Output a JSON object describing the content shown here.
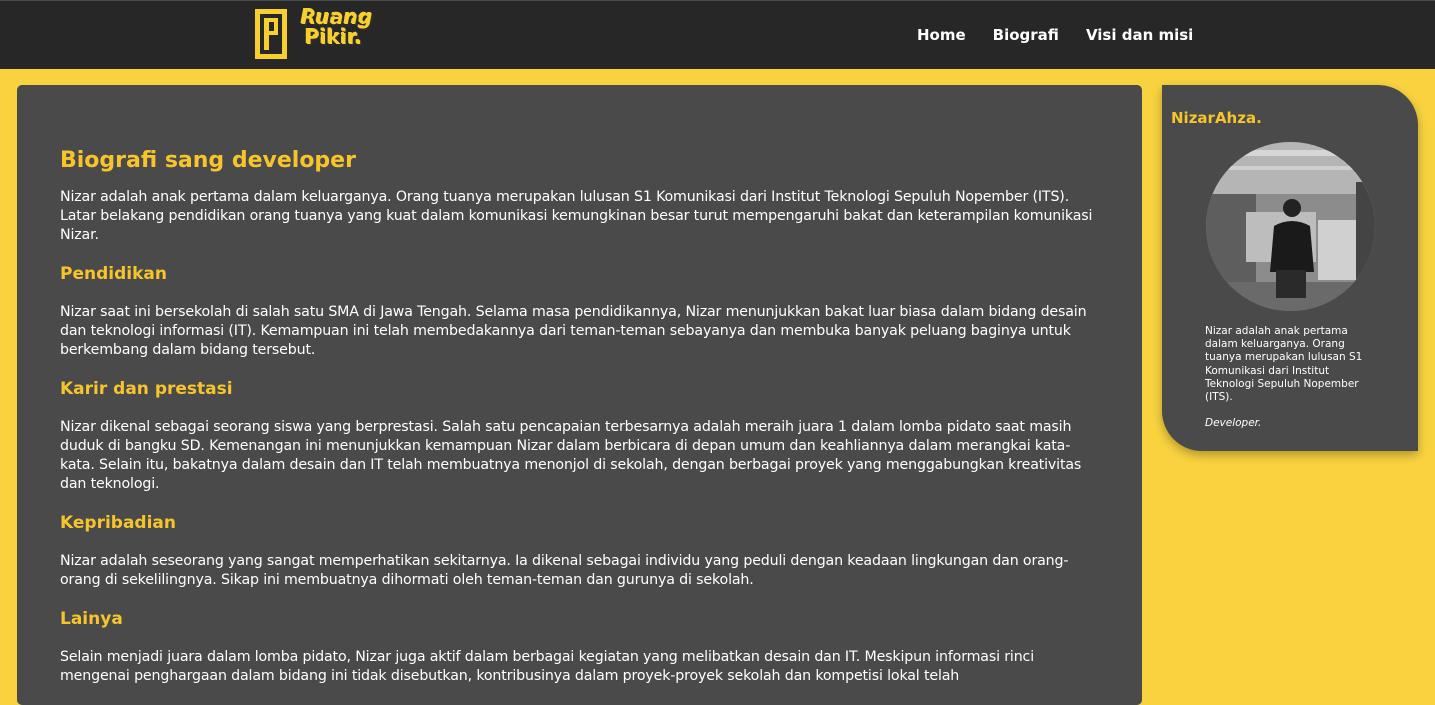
{
  "nav": {
    "logo": {
      "line1": "Ruang",
      "line2": "Pikir."
    },
    "links": [
      "Home",
      "Biografi",
      "Visi dan misi"
    ]
  },
  "main": {
    "title": "Biografi sang developer",
    "intro": "Nizar adalah anak pertama dalam keluarganya. Orang tuanya merupakan lulusan S1 Komunikasi dari Institut Teknologi Sepuluh Nopember (ITS). Latar belakang pendidikan orang tuanya yang kuat dalam komunikasi kemungkinan besar turut mempengaruhi bakat dan keterampilan komunikasi Nizar.",
    "sections": [
      {
        "title": "Pendidikan",
        "text": "Nizar saat ini bersekolah di salah satu SMA di Jawa Tengah. Selama masa pendidikannya, Nizar menunjukkan bakat luar biasa dalam bidang desain dan teknologi informasi (IT). Kemampuan ini telah membedakannya dari teman-teman sebayanya dan membuka banyak peluang baginya untuk berkembang dalam bidang tersebut."
      },
      {
        "title": "Karir dan prestasi",
        "text": "Nizar dikenal sebagai seorang siswa yang berprestasi. Salah satu pencapaian terbesarnya adalah meraih juara 1 dalam lomba pidato saat masih duduk di bangku SD. Kemenangan ini menunjukkan kemampuan Nizar dalam berbicara di depan umum dan keahliannya dalam merangkai kata-kata. Selain itu, bakatnya dalam desain dan IT telah membuatnya menonjol di sekolah, dengan berbagai proyek yang menggabungkan kreativitas dan teknologi."
      },
      {
        "title": "Kepribadian",
        "text": "Nizar adalah seseorang yang sangat memperhatikan sekitarnya. Ia dikenal sebagai individu yang peduli dengan keadaan lingkungan dan orang-orang di sekelilingnya. Sikap ini membuatnya dihormati oleh teman-teman dan gurunya di sekolah."
      },
      {
        "title": "Lainya",
        "text": "Selain menjadi juara dalam lomba pidato, Nizar juga aktif dalam berbagai kegiatan yang melibatkan desain dan IT. Meskipun informasi rinci mengenai penghargaan dalam bidang ini tidak disebutkan, kontribusinya dalam proyek-proyek sekolah dan kompetisi lokal telah"
      }
    ]
  },
  "profile": {
    "name": "NizarAhza.",
    "description": "Nizar adalah anak pertama dalam keluarganya. Orang tuanya merupakan lulusan S1 Komunikasi dari Institut Teknologi Sepuluh Nopember (ITS).",
    "role": "Developer."
  },
  "colors": {
    "background": "#f9d33f",
    "navbar": "#272727",
    "panel": "#4a4a4a",
    "accent": "#f7c52b"
  }
}
